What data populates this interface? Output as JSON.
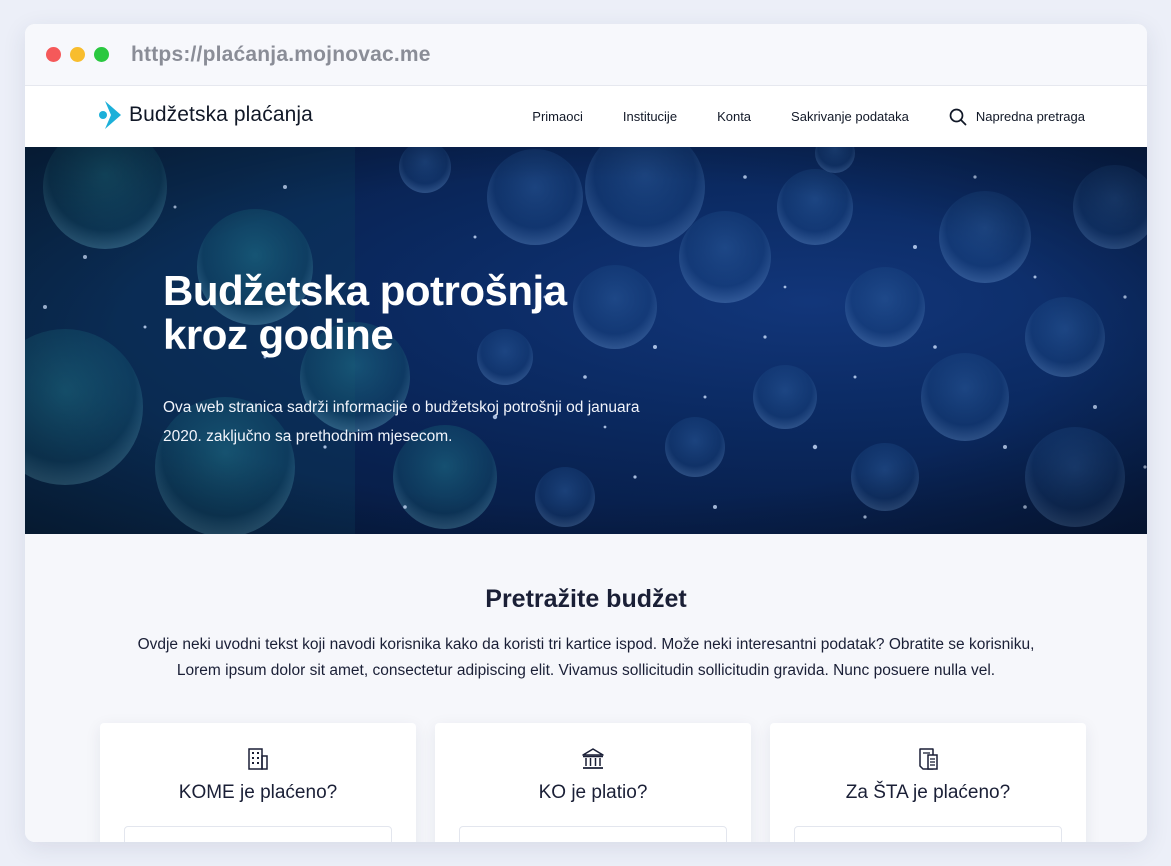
{
  "browser": {
    "url": "https://plaćanja.mojnovac.me",
    "dot_colors": [
      "#f5595a",
      "#f8bd2e",
      "#2ac840"
    ]
  },
  "header": {
    "logo_text": "Budžetska plaćanja",
    "logo_color": "#1cb0d9",
    "nav": {
      "primaoci": "Primaoci",
      "institucije": "Institucije",
      "konta": "Konta",
      "sakrivanje": "Sakrivanje podataka",
      "napredna": "Napredna pretraga"
    }
  },
  "hero": {
    "title_line1": "Budžetska potrošnja",
    "title_line2": "kroz godine",
    "text_line1": "Ova web stranica sadrži informacije o budžetskoj potrošnji od januara",
    "text_line2": "2020. zaključno sa prethodnim mjesecom."
  },
  "search": {
    "title": "Pretražite budžet",
    "intro_line1": "Ovdje neki uvodni tekst koji navodi korisnika kako da koristi tri kartice ispod. Može neki interesantni podatak? Obratite se korisniku,",
    "intro_line2": "Lorem ipsum dolor sit amet, consectetur adipiscing elit. Vivamus sollicitudin sollicitudin gravida. Nunc posuere nulla vel."
  },
  "cards": [
    {
      "title": "KOME je plaćeno?",
      "icon": "building-icon"
    },
    {
      "title": "KO je platio?",
      "icon": "institution-icon"
    },
    {
      "title": "Za ŠTA je plaćeno?",
      "icon": "document-icon"
    }
  ]
}
